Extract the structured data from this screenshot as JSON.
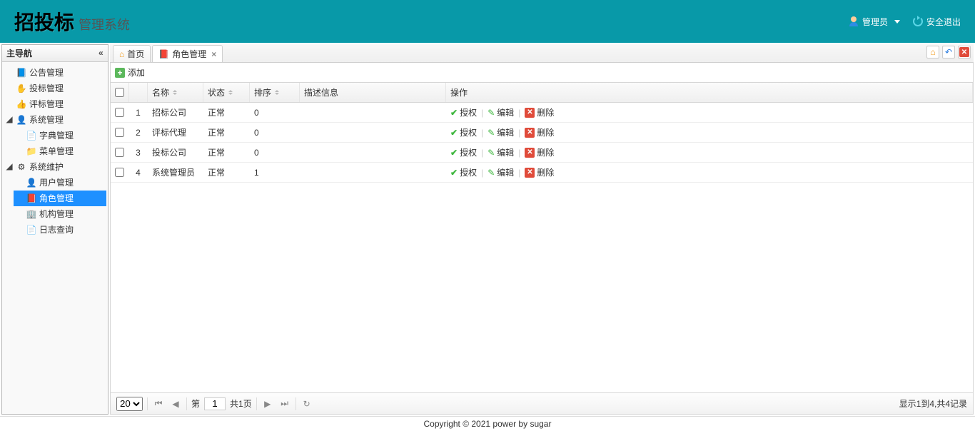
{
  "header": {
    "logo_main": "招投标",
    "logo_sub": "管理系统",
    "user_label": "管理员",
    "logout_label": "安全退出"
  },
  "sidebar": {
    "title": "主导航",
    "nodes": [
      {
        "label": "公告管理",
        "icon": "📘",
        "leaf": true
      },
      {
        "label": "投标管理",
        "icon": "✋",
        "leaf": true
      },
      {
        "label": "评标管理",
        "icon": "👍",
        "leaf": true
      },
      {
        "label": "系统管理",
        "icon": "👤",
        "leaf": false,
        "expanded": true,
        "children": [
          {
            "label": "字典管理",
            "icon": "📄",
            "leaf": true
          },
          {
            "label": "菜单管理",
            "icon": "📁",
            "leaf": true
          }
        ]
      },
      {
        "label": "系统维护",
        "icon": "⚙",
        "leaf": false,
        "expanded": true,
        "children": [
          {
            "label": "用户管理",
            "icon": "👤",
            "leaf": true
          },
          {
            "label": "角色管理",
            "icon": "📕",
            "leaf": true,
            "selected": true
          },
          {
            "label": "机构管理",
            "icon": "🏢",
            "leaf": true
          },
          {
            "label": "日志查询",
            "icon": "📄",
            "leaf": true
          }
        ]
      }
    ]
  },
  "tabs": {
    "home_label": "首页",
    "active_label": "角色管理",
    "tools_home_title": "home",
    "tools_back_title": "back",
    "tools_close_title": "close"
  },
  "toolbar": {
    "add_label": "添加"
  },
  "grid": {
    "columns": {
      "name": "名称",
      "status": "状态",
      "sort": "排序",
      "desc": "描述信息",
      "ops": "操作"
    },
    "op_labels": {
      "auth": "授权",
      "edit": "编辑",
      "del": "删除"
    },
    "rows": [
      {
        "idx": "1",
        "name": "招标公司",
        "status": "正常",
        "sort": "0",
        "desc": ""
      },
      {
        "idx": "2",
        "name": "评标代理",
        "status": "正常",
        "sort": "0",
        "desc": ""
      },
      {
        "idx": "3",
        "name": "投标公司",
        "status": "正常",
        "sort": "0",
        "desc": ""
      },
      {
        "idx": "4",
        "name": "系统管理员",
        "status": "正常",
        "sort": "1",
        "desc": ""
      }
    ]
  },
  "pager": {
    "page_size": "20",
    "page_prefix": "第",
    "page_value": "1",
    "page_total": "共1页",
    "status": "显示1到4,共4记录"
  },
  "footer": {
    "text": "Copyright © 2021 power by sugar"
  }
}
